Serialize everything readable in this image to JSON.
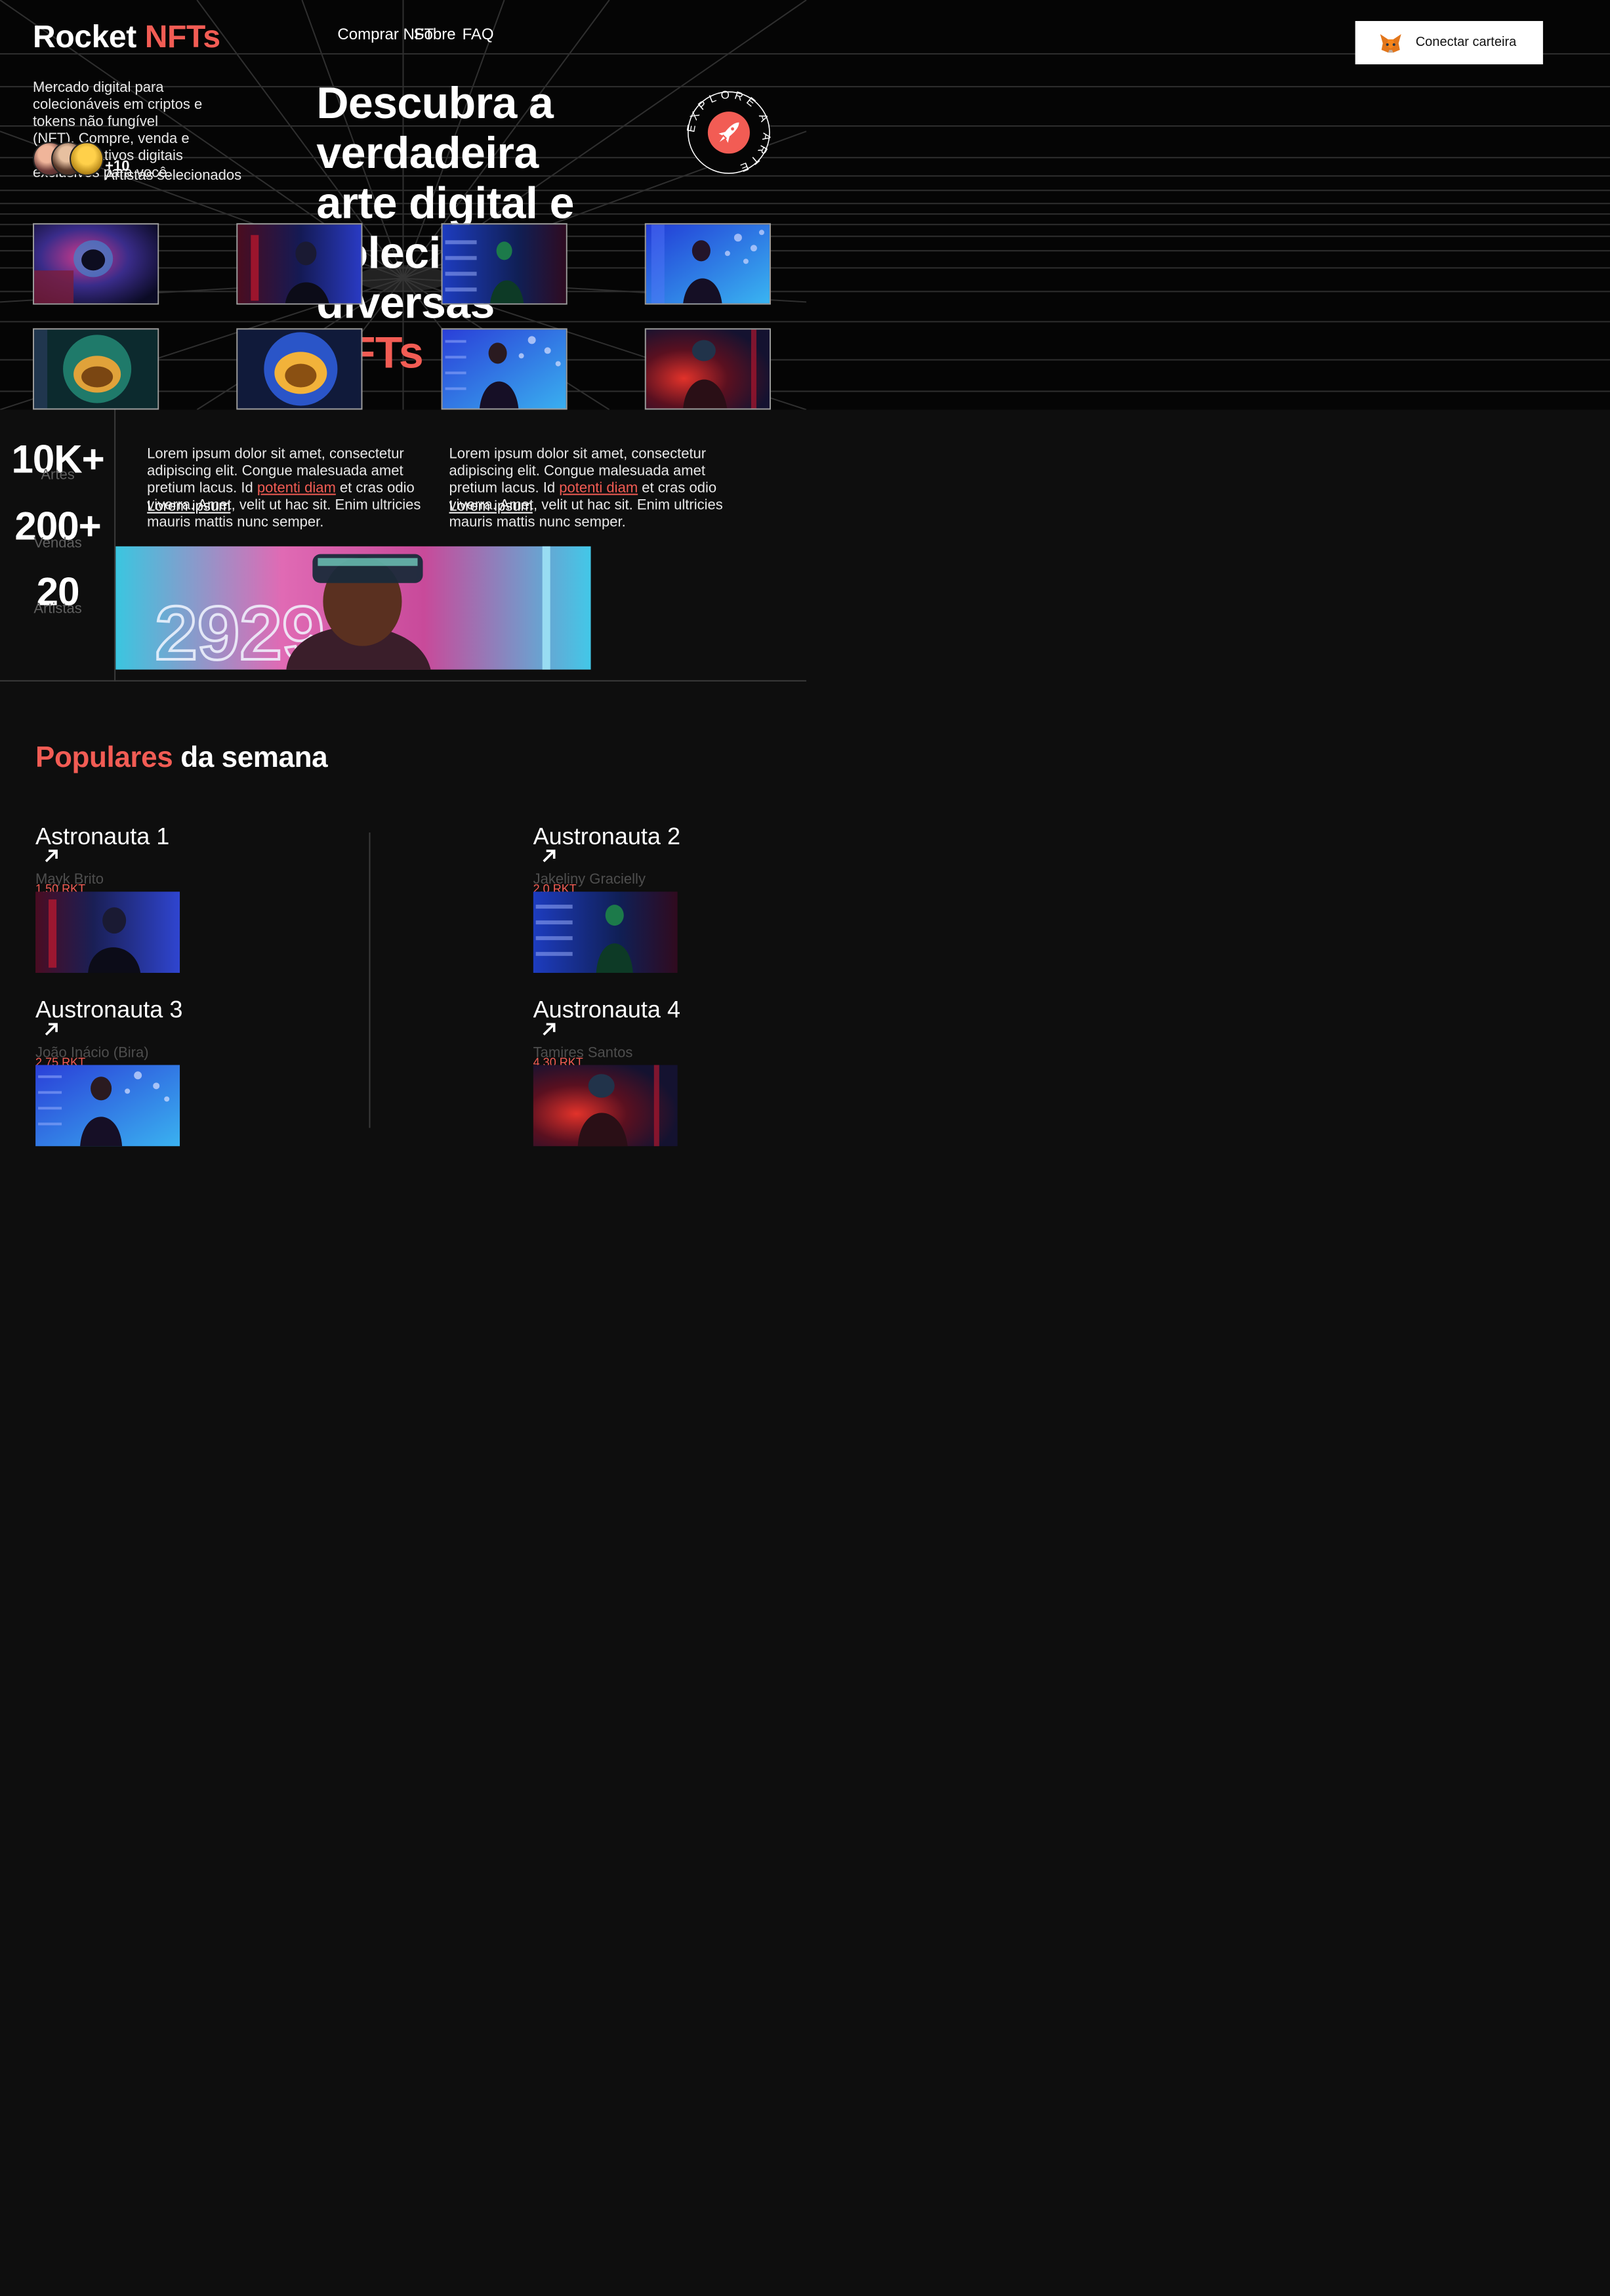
{
  "brand": {
    "name": "Rocket",
    "accent": "NFTs",
    "accent_color": "#f25c54"
  },
  "nav": [
    {
      "label": "Comprar NFT"
    },
    {
      "label": "Sobre"
    },
    {
      "label": "FAQ"
    }
  ],
  "wallet_button": {
    "label": "Conectar carteira",
    "icon": "metamask-fox-icon"
  },
  "hero": {
    "intro": "Mercado digital para colecionáveis em criptos e tokens não fungível (NFT). Compre, venda e descubra ativos digitais exclusivos para você.",
    "artists_count": "+10",
    "artists_label": "Artistas selecionados",
    "headline": "Descubra a verdadeira arte digital e colecione diversas",
    "headline_accent": "NFTs",
    "badge_text": "EXPLORE A ARTE",
    "badge_icon": "rocket-icon"
  },
  "gallery": [
    {
      "name": "astronaut-pink"
    },
    {
      "name": "hooded-red"
    },
    {
      "name": "green-helmet"
    },
    {
      "name": "blue-bokeh"
    },
    {
      "name": "helmet-green-gold"
    },
    {
      "name": "helmet-gold"
    },
    {
      "name": "blue-bokeh-2"
    },
    {
      "name": "red-glow"
    }
  ],
  "stats": [
    {
      "value": "10K+",
      "label": "Artes"
    },
    {
      "value": "200+",
      "label": "Vendas"
    },
    {
      "value": "20",
      "label": "Artistas"
    }
  ],
  "about": [
    {
      "text_before": "Lorem ipsum dolor sit amet, consectetur adipiscing elit. Congue malesuada amet pretium lacus. Id ",
      "highlight": "potenti diam",
      "text_after": " et cras odio viverra. Amet, velit ut hac sit. Enim ultricies mauris mattis nunc semper.",
      "link": "Lorem ipsum"
    },
    {
      "text_before": "Lorem ipsum dolor sit amet, consectetur adipiscing elit. Congue malesuada amet pretium lacus. Id ",
      "highlight": "potenti diam",
      "text_after": " et cras odio viverra. Amet, velit ut hac sit. Enim ultricies mauris mattis nunc semper.",
      "link": "Lorem ipsum"
    }
  ],
  "banner": {
    "neon_text": "2929"
  },
  "populares": {
    "title_accent": "Populares",
    "title_rest": " da semana",
    "cards": [
      {
        "title": "Astronauta 1",
        "artist": "Mayk Brito",
        "price": "1.50 RKT"
      },
      {
        "title": "Austronauta 2",
        "artist": "Jakeliny Gracielly",
        "price": "2.0 RKT"
      },
      {
        "title": "Austronauta 3",
        "artist": "João Inácio (Bira)",
        "price": "2.75 RKT"
      },
      {
        "title": "Austronauta 4",
        "artist": "Tamires Santos",
        "price": "4.30 RKT"
      }
    ]
  }
}
